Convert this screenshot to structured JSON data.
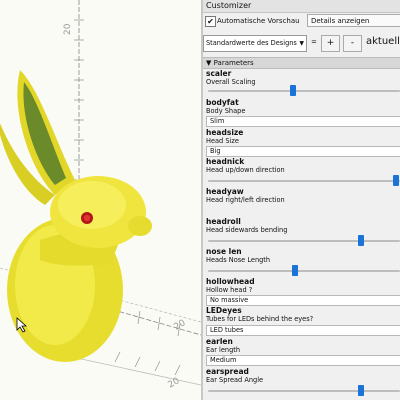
{
  "viewport": {
    "axis_labels": [
      "20",
      "20",
      "20"
    ]
  },
  "customizer": {
    "title": "Customizer",
    "auto_preview": {
      "label": "Automatische Vorschau",
      "checked": true
    },
    "details_button": "Details anzeigen",
    "preset_select": "Standardwerte des Designs",
    "preset_separator": "=",
    "add_label": "+",
    "remove_label": "-",
    "current_label": "aktuelle",
    "parameters_header": "Parameters",
    "params": [
      {
        "name": "scaler",
        "desc": "Overall Scaling",
        "kind": "slider",
        "value": 0.45
      },
      {
        "name": "bodyfat",
        "desc": "Body Shape",
        "kind": "combo",
        "value": "Slim"
      },
      {
        "name": "headsize",
        "desc": "Head Size",
        "kind": "combo",
        "value": "Big"
      },
      {
        "name": "headnick",
        "desc": "Head up/down direction",
        "kind": "slider",
        "value": 0.98
      },
      {
        "name": "headyaw",
        "desc": "Head right/left direction",
        "kind": "none"
      },
      {
        "name": "headroll",
        "desc": "Head sidewards bending",
        "kind": "slider",
        "value": 0.8
      },
      {
        "name": "nose len",
        "desc": "Heads Nose Length",
        "kind": "slider",
        "value": 0.46
      },
      {
        "name": "hollowhead",
        "desc": "Hollow head ?",
        "kind": "combo",
        "value": "No massive"
      },
      {
        "name": "LEDeyes",
        "desc": "Tubes for LEDs behind the eyes?",
        "kind": "combo",
        "value": "LED tubes"
      },
      {
        "name": "earlen",
        "desc": "Ear length",
        "kind": "combo",
        "value": "Medium"
      },
      {
        "name": "earspread",
        "desc": "Ear Spread Angle",
        "kind": "slider",
        "value": 0.8
      }
    ]
  }
}
